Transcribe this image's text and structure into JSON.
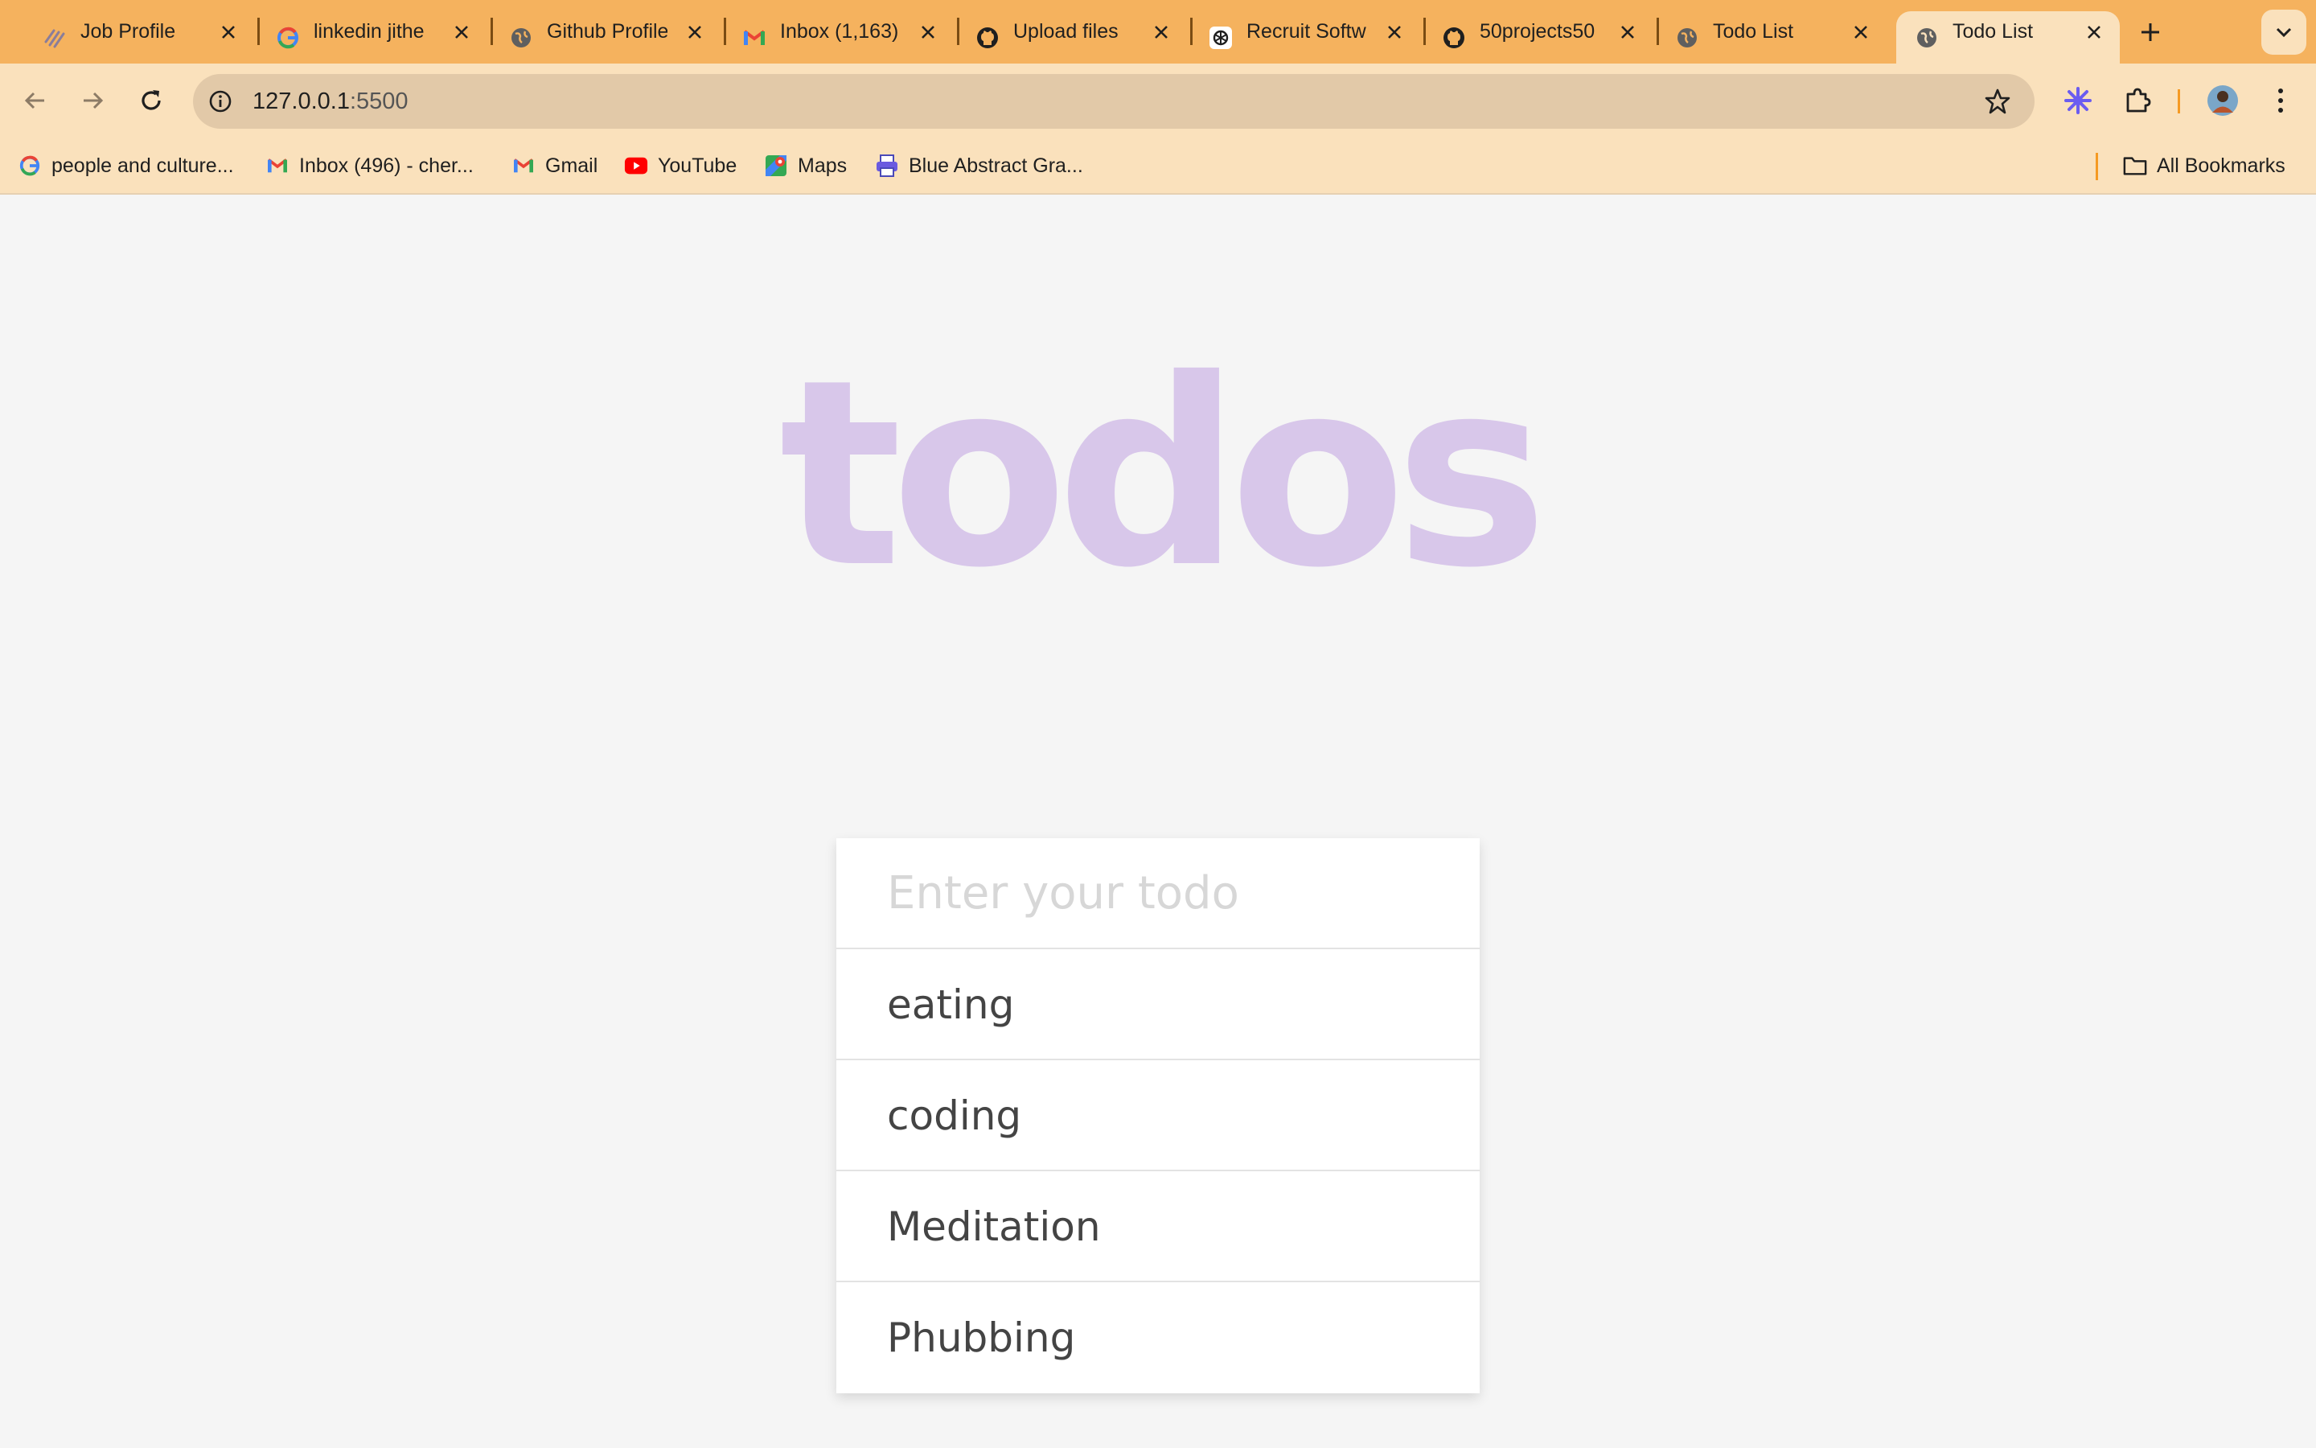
{
  "browser": {
    "tabs": [
      {
        "title": "Job Profile",
        "icon": "recruit-logo-icon",
        "active": false
      },
      {
        "title": "linkedin jithe",
        "icon": "google-g-icon",
        "active": false
      },
      {
        "title": "Github Profile",
        "icon": "globe-icon",
        "active": false
      },
      {
        "title": "Inbox (1,163)",
        "icon": "gmail-icon",
        "active": false
      },
      {
        "title": "Upload files",
        "icon": "github-icon",
        "active": false
      },
      {
        "title": "Recruit Softw",
        "icon": "openai-icon",
        "active": false
      },
      {
        "title": "50projects50",
        "icon": "github-icon",
        "active": false
      },
      {
        "title": "Todo List",
        "icon": "globe-icon",
        "active": false
      },
      {
        "title": "Todo List",
        "icon": "globe-icon",
        "active": true
      }
    ],
    "address": {
      "host": "127.0.0.1",
      "port": ":5500"
    },
    "bookmarks": [
      {
        "label": "people and culture...",
        "icon": "google-g-icon"
      },
      {
        "label": "Inbox (496) - cher...",
        "icon": "gmail-icon"
      },
      {
        "label": "Gmail",
        "icon": "gmail-icon"
      },
      {
        "label": "YouTube",
        "icon": "youtube-icon"
      },
      {
        "label": "Maps",
        "icon": "maps-icon"
      },
      {
        "label": "Blue Abstract Gra...",
        "icon": "printer-icon"
      }
    ],
    "all_bookmarks_label": "All Bookmarks",
    "colors": {
      "tabstrip": "#f5b25e",
      "toolbar": "#fae1bc",
      "accent": "#f59a23"
    }
  },
  "app": {
    "heading": "todos",
    "input": {
      "placeholder": "Enter your todo",
      "value": ""
    },
    "todos": [
      "eating",
      "coding",
      "Meditation",
      "Phubbing"
    ],
    "colors": {
      "heading": "#d8c7ea",
      "text": "#444444",
      "background": "#f5f5f5"
    }
  }
}
